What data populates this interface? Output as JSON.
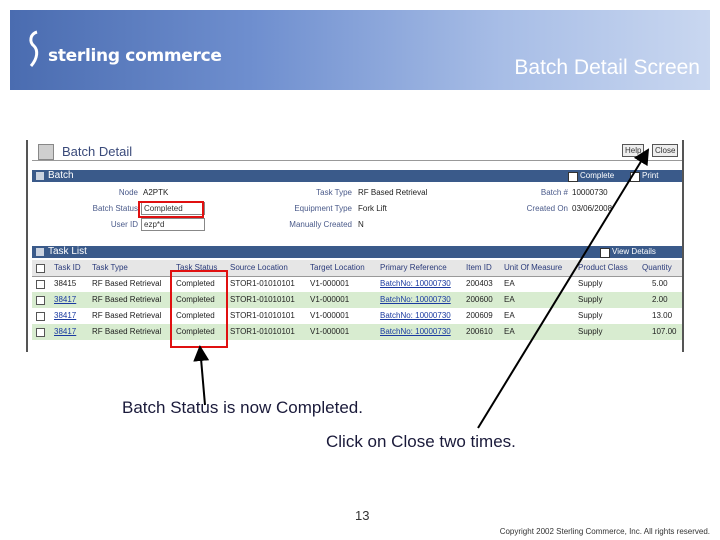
{
  "banner": {
    "logo_text": "sterling commerce",
    "slide_title": "Batch Detail Screen"
  },
  "app": {
    "page_title": "Batch Detail",
    "help_label": "Help",
    "close_label": "Close",
    "batch_section": {
      "title": "Batch",
      "complete_label": "Complete",
      "print_label": "Print",
      "node_label": "Node",
      "node_value": "A2PTK",
      "batch_status_label": "Batch Status",
      "batch_status_value": "Completed",
      "user_id_label": "User ID",
      "user_id_value": "ezp*d",
      "task_type_label": "Task Type",
      "task_type_value": "RF Based Retrieval",
      "equipment_type_label": "Equipment Type",
      "equipment_type_value": "Fork Lift",
      "manually_created_label": "Manually Created",
      "manually_created_value": "N",
      "batch_no_label": "Batch #",
      "batch_no_value": "10000730",
      "created_on_label": "Created On",
      "created_on_value": "03/06/2008"
    },
    "task_list": {
      "title": "Task List",
      "view_details_label": "View Details",
      "columns": [
        "Task ID",
        "Task Type",
        "Task Status",
        "Source Location",
        "Target Location",
        "Primary Reference",
        "Item ID",
        "Unit Of Measure",
        "Product Class",
        "Quantity"
      ],
      "rows": [
        {
          "task_id": "38415",
          "task_type": "RF Based Retrieval",
          "status": "Completed",
          "source": "STOR1-01010101",
          "target": "V1-000001",
          "reference": "BatchNo: 10000730",
          "item": "200403",
          "uom": "EA",
          "product_class": "Supply",
          "quantity": "5.00"
        },
        {
          "task_id": "38417",
          "task_type": "RF Based Retrieval",
          "status": "Completed",
          "source": "STOR1-01010101",
          "target": "V1-000001",
          "reference": "BatchNo: 10000730",
          "item": "200600",
          "uom": "EA",
          "product_class": "Supply",
          "quantity": "2.00"
        },
        {
          "task_id": "38417",
          "task_type": "RF Based Retrieval",
          "status": "Completed",
          "source": "STOR1-01010101",
          "target": "V1-000001",
          "reference": "BatchNo: 10000730",
          "item": "200609",
          "uom": "EA",
          "product_class": "Supply",
          "quantity": "13.00"
        },
        {
          "task_id": "38417",
          "task_type": "RF Based Retrieval",
          "status": "Completed",
          "source": "STOR1-01010101",
          "target": "V1-000001",
          "reference": "BatchNo: 10000730",
          "item": "200610",
          "uom": "EA",
          "product_class": "Supply",
          "quantity": "107.00"
        }
      ]
    }
  },
  "callouts": {
    "status_note": "Batch Status is now Completed.",
    "close_note": "Click on Close two times."
  },
  "footer": {
    "page_number": "13",
    "copyright": "Copyright 2002 Sterling Commerce, Inc. All rights reserved."
  },
  "colors": {
    "banner": "#5a7cc0",
    "highlight": "#e01010",
    "section_bar": "#3a5a8a",
    "row_alt": "#d8ecd0"
  }
}
